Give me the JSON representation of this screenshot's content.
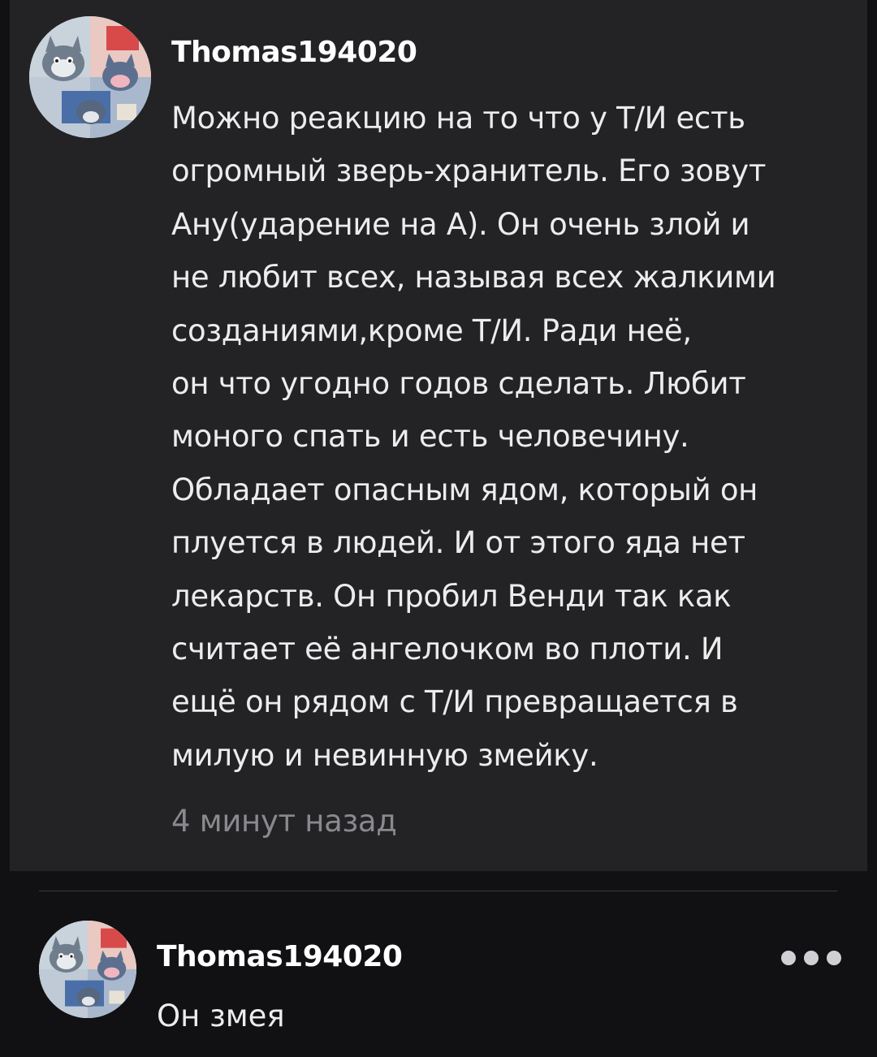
{
  "comment": {
    "username": "Thomas194020",
    "body_lines": [
      "Можно реакцию на то что у Т/И есть",
      "огромный зверь-хранитель. Его зовут",
      "Ану(ударение на А). Он очень злой и",
      "не любит всех, называя всех жалкими",
      "созданиями,кроме Т/И. Ради неё,",
      "он что угодно годов сделать. Любит",
      "моного спать и есть человечину.",
      "Обладает опасным ядом, который он",
      "плуется в людей. И от этого яда нет",
      "лекарств. Он пробил Венди так как",
      "считает её ангелочком во плоти. И",
      "ещё он рядом с Т/И превращается в",
      "милую и невинную змейку."
    ],
    "timestamp": "4 минут назад"
  },
  "reply": {
    "username": "Thomas194020",
    "text": "Он змея",
    "more_icon": "more-dots-icon"
  },
  "colors": {
    "background": "#111114",
    "card": "#232326",
    "text": "#ececec",
    "muted": "#8a8a8e"
  }
}
